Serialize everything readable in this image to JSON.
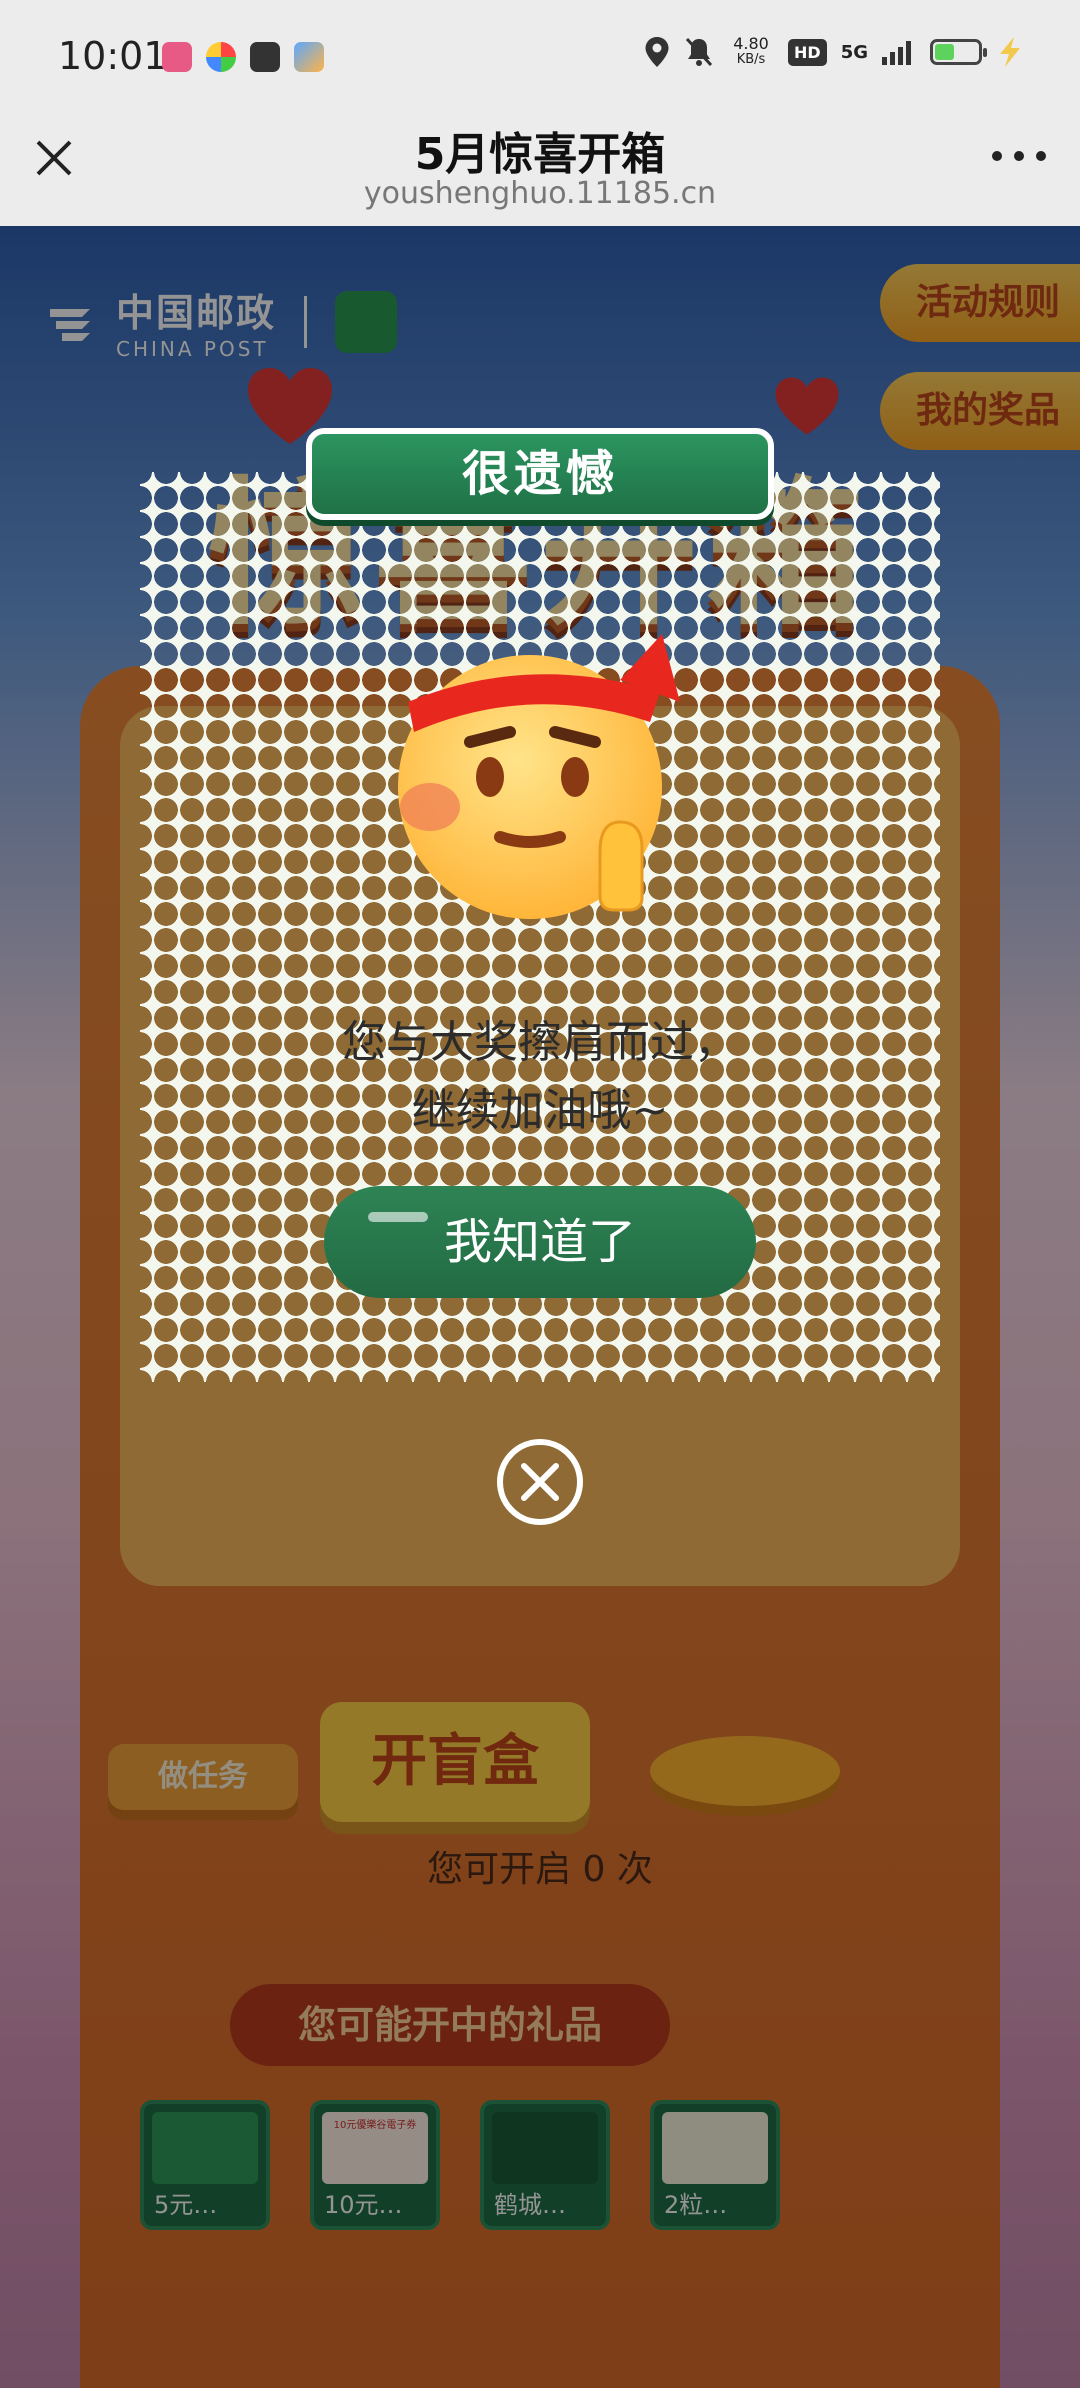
{
  "status_bar": {
    "time": "10:01",
    "speed_value": "4.80",
    "speed_unit": "KB/s",
    "hd": "HD",
    "network": "5G",
    "battery_level": 0.45,
    "icons": [
      "app-icon-1",
      "app-icon-2",
      "app-icon-3",
      "app-icon-4",
      "location-icon",
      "mute-icon",
      "signal-icon",
      "battery-icon",
      "charging-icon"
    ]
  },
  "title_bar": {
    "title": "5月惊喜开箱",
    "url": "youshenghuo.11185.cn"
  },
  "page": {
    "logo_cn": "中国邮政",
    "logo_en": "CHINA POST",
    "rules_label": "活动规则",
    "prizes_label": "我的奖品",
    "big_title": "惊喜开箱",
    "task_label": "做任务",
    "open_label": "开盲盒",
    "times_text": "您可开启 0 次",
    "gift_title": "您可能开中的礼品",
    "gifts": [
      {
        "label": "5元…"
      },
      {
        "label": "10元…"
      },
      {
        "label": "鹤城…"
      },
      {
        "label": "2粒…"
      }
    ],
    "gift_badge": "10元優樂谷電子券"
  },
  "modal": {
    "banner": "很遗憾",
    "line1": "您与大奖擦肩而过，",
    "line2": "继续加油哦~",
    "button": "我知道了"
  },
  "colors": {
    "modal_green": "#2e8455",
    "banner_green": "#1f7146",
    "stamp_bg": "#f4f7ee",
    "pill_orange": "#f8a426"
  }
}
